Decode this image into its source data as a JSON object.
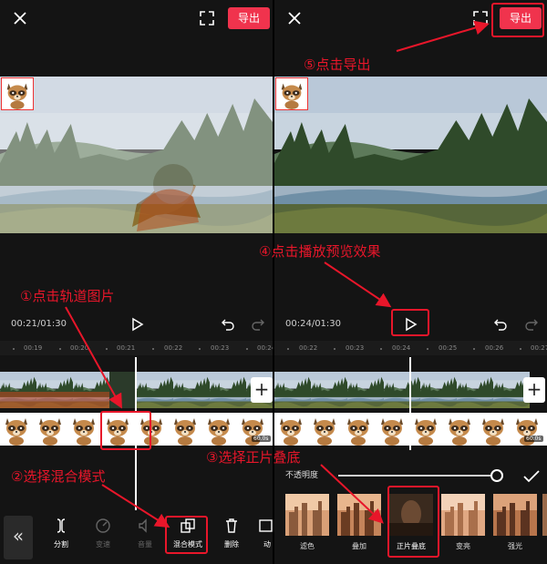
{
  "left": {
    "export_label": "导出",
    "timecode": "00:21/01:30",
    "ruler_ticks": [
      "00:19",
      "00:20",
      "00:21",
      "00:22",
      "00:23",
      "00:24"
    ],
    "duration_badge": "60.0s",
    "tools": [
      {
        "label": "分割",
        "icon": "split-icon",
        "active": true
      },
      {
        "label": "变速",
        "icon": "speed-icon",
        "active": false
      },
      {
        "label": "音量",
        "icon": "volume-icon",
        "active": false
      },
      {
        "label": "混合模式",
        "icon": "blend-mode-icon",
        "active": true
      },
      {
        "label": "删除",
        "icon": "delete-icon",
        "active": true
      },
      {
        "label": "动",
        "icon": "animation-icon",
        "active": true
      }
    ]
  },
  "right": {
    "export_label": "导出",
    "timecode": "00:24/01:30",
    "ruler_ticks": [
      "00:22",
      "00:23",
      "00:24",
      "00:25",
      "00:26",
      "00:27"
    ],
    "duration_badge": "60.0s",
    "opacity_label": "不透明度",
    "opacity_value": 1.0,
    "blend_modes": [
      {
        "label": "滤色",
        "selected": false
      },
      {
        "label": "叠加",
        "selected": false
      },
      {
        "label": "正片叠底",
        "selected": true
      },
      {
        "label": "变亮",
        "selected": false
      },
      {
        "label": "强光",
        "selected": false
      }
    ]
  },
  "annotations": {
    "step1": "①点击轨道图片",
    "step2": "②选择混合模式",
    "step3": "③选择正片叠底",
    "step4": "④点击播放预览效果",
    "step5": "⑤点击导出"
  },
  "colors": {
    "accent": "#f0334d",
    "annotation": "#e8162a",
    "background": "#141414"
  }
}
